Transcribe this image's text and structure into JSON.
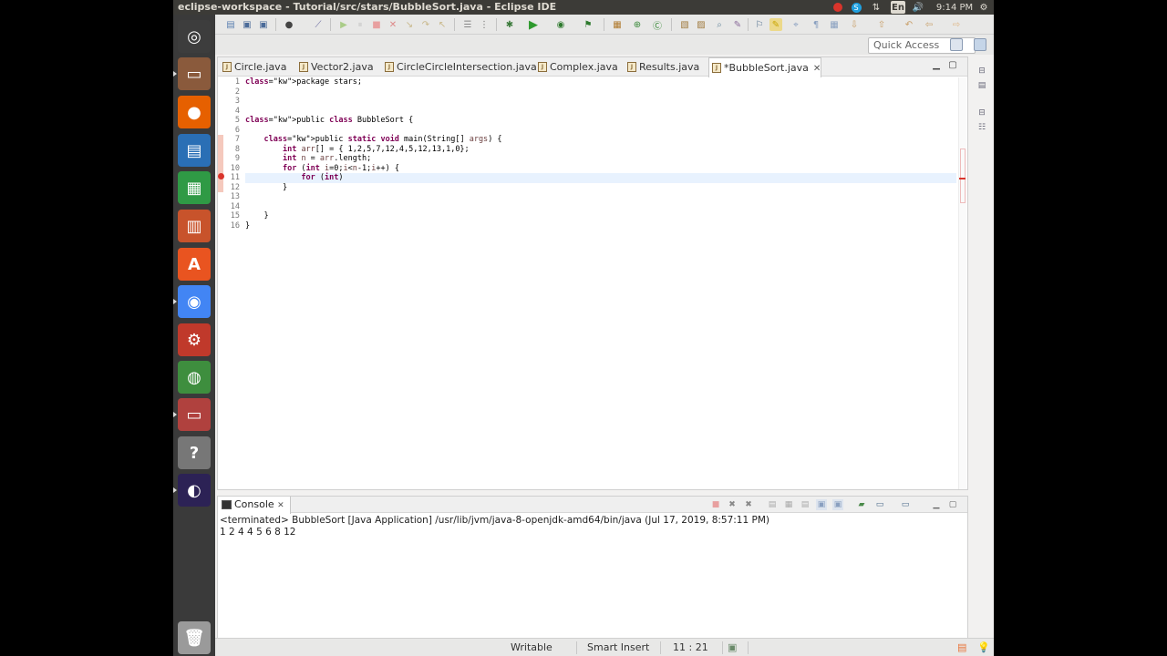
{
  "window": {
    "title": "eclipse-workspace - Tutorial/src/stars/BubbleSort.java - Eclipse IDE"
  },
  "system_tray": {
    "keyboard": "En",
    "clock": "9:14 PM"
  },
  "launcher": [
    {
      "name": "ubuntu-dash-icon",
      "color": "#3d3d3d"
    },
    {
      "name": "files-icon",
      "color": "#8a5a3c"
    },
    {
      "name": "firefox-icon",
      "color": "#e66000"
    },
    {
      "name": "libreoffice-writer-icon",
      "color": "#2a6fb5"
    },
    {
      "name": "libreoffice-calc-icon",
      "color": "#2f9a45"
    },
    {
      "name": "libreoffice-impress-icon",
      "color": "#c8532b"
    },
    {
      "name": "software-center-icon",
      "color": "#e95420"
    },
    {
      "name": "chrome-icon",
      "color": "#4285f4"
    },
    {
      "name": "system-settings-icon",
      "color": "#c0392b"
    },
    {
      "name": "globe-icon",
      "color": "#3e8e3e"
    },
    {
      "name": "files-icon-2",
      "color": "#b0413e"
    },
    {
      "name": "help-icon",
      "color": "#777777"
    },
    {
      "name": "eclipse-icon",
      "color": "#2c2255"
    },
    {
      "name": "trash-icon",
      "color": "#9a9a9a"
    }
  ],
  "quick_access": {
    "label": "Quick Access"
  },
  "editor": {
    "tabs": [
      {
        "label": "Circle.java",
        "active": false
      },
      {
        "label": "Vector2.java",
        "active": false
      },
      {
        "label": "CircleCircleIntersection.java",
        "active": false
      },
      {
        "label": "Complex.java",
        "active": false
      },
      {
        "label": "Results.java",
        "active": false
      },
      {
        "label": "*BubbleSort.java",
        "active": true
      }
    ],
    "line_numbers": [
      "1",
      "2",
      "3",
      "4",
      "5",
      "6",
      "7",
      "8",
      "9",
      "10",
      "11",
      "12",
      "13",
      "14",
      "15",
      "16"
    ],
    "lines": [
      "package stars;",
      "",
      "",
      "",
      "public class BubbleSort {",
      "",
      "    public static void main(String[] args) {",
      "        int arr[] = { 1,2,5,7,12,4,5,12,13,1,0};",
      "        int n = arr.length;",
      "        for (int i=0;i<n-1;i++) {",
      "            for (int)",
      "        }",
      "",
      "",
      "    }",
      "}"
    ],
    "current_line": 10
  },
  "console": {
    "tab_label": "Console",
    "status": "<terminated> BubbleSort [Java Application] /usr/lib/jvm/java-8-openjdk-amd64/bin/java (Jul 17, 2019, 8:57:11 PM)",
    "output": "1 2 4 4 5 6 8 12"
  },
  "statusbar": {
    "writable": "Writable",
    "insert_mode": "Smart Insert",
    "position": "11 : 21"
  }
}
